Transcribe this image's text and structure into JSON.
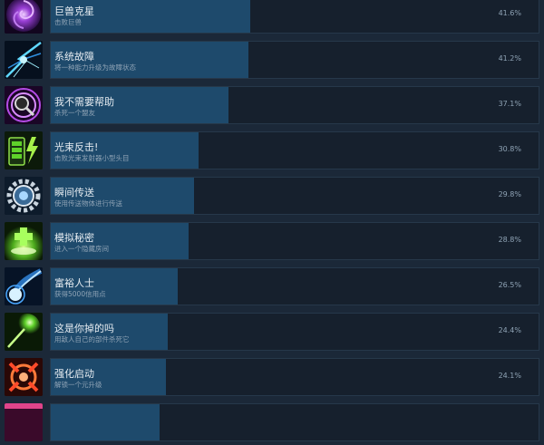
{
  "achievements": [
    {
      "title": "巨兽克星",
      "description": "击败巨兽",
      "percent": "41.6%",
      "fraction": 0.416,
      "icon": "purple-vortex-icon"
    },
    {
      "title": "系统故障",
      "description": "将一种能力升级为故障状态",
      "percent": "41.2%",
      "fraction": 0.412,
      "icon": "blue-lightning-burst-icon"
    },
    {
      "title": "我不需要帮助",
      "description": "杀死一个盟友",
      "percent": "37.1%",
      "fraction": 0.371,
      "icon": "magnifying-glass-vortex-icon"
    },
    {
      "title": "光束反击!",
      "description": "击败光束发射器小型头目",
      "percent": "30.8%",
      "fraction": 0.308,
      "icon": "battery-lightning-icon"
    },
    {
      "title": "瞬间传送",
      "description": "使用传送物体进行传送",
      "percent": "29.8%",
      "fraction": 0.298,
      "icon": "gear-portal-icon"
    },
    {
      "title": "模拟秘密",
      "description": "进入一个隐藏房间",
      "percent": "28.8%",
      "fraction": 0.288,
      "icon": "green-plus-glow-icon"
    },
    {
      "title": "富裕人士",
      "description": "获得5000信用点",
      "percent": "26.5%",
      "fraction": 0.265,
      "icon": "blue-comet-icon"
    },
    {
      "title": "这是你掉的吗",
      "description": "用敌人自己的部件杀死它",
      "percent": "24.4%",
      "fraction": 0.244,
      "icon": "green-energy-orb-icon"
    },
    {
      "title": "强化启动",
      "description": "解锁一个元升级",
      "percent": "24.1%",
      "fraction": 0.241,
      "icon": "red-target-icon"
    },
    {
      "title": "",
      "description": "",
      "percent": "",
      "fraction": 0,
      "icon": "pink-partial-icon"
    }
  ]
}
